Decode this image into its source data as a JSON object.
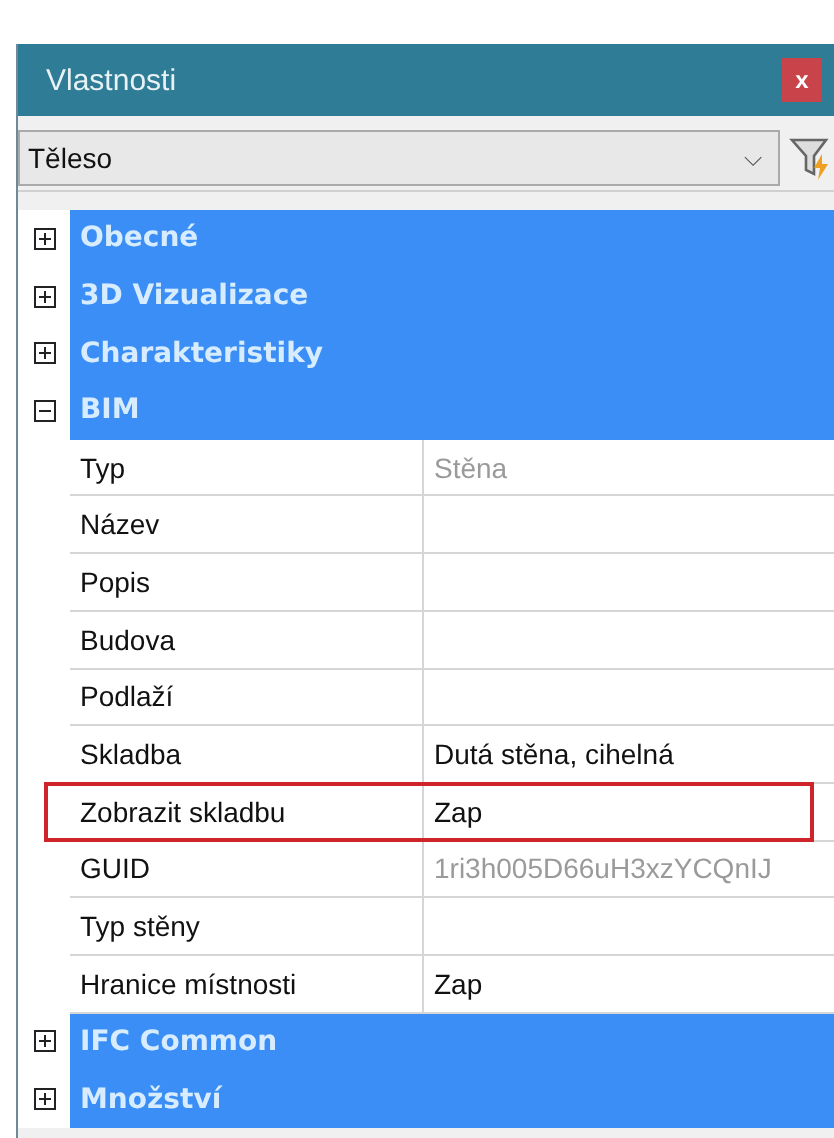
{
  "window": {
    "title": "Vlastnosti",
    "close": "x"
  },
  "selector": {
    "value": "Těleso",
    "arrow": "⌵"
  },
  "groups": [
    {
      "title": "Obecné",
      "expanded": false
    },
    {
      "title": "3D Vizualizace",
      "expanded": false
    },
    {
      "title": "Charakteristiky",
      "expanded": false
    },
    {
      "title": "BIM",
      "expanded": true,
      "rows": [
        {
          "label": "Typ",
          "value": "Stěna",
          "readonly": true,
          "highlighted": false
        },
        {
          "label": "Název",
          "value": "",
          "readonly": false,
          "highlighted": false
        },
        {
          "label": "Popis",
          "value": "",
          "readonly": false,
          "highlighted": false
        },
        {
          "label": "Budova",
          "value": "",
          "readonly": false,
          "highlighted": false
        },
        {
          "label": "Podlaží",
          "value": "",
          "readonly": false,
          "highlighted": false
        },
        {
          "label": "Skladba",
          "value": "Dutá stěna, cihelná",
          "readonly": false,
          "highlighted": false
        },
        {
          "label": "Zobrazit skladbu",
          "value": "Zap",
          "readonly": false,
          "highlighted": true
        },
        {
          "label": "GUID",
          "value": "1ri3h005D66uH3xzYCQnIJ",
          "readonly": true,
          "highlighted": false
        },
        {
          "label": "Typ stěny",
          "value": "",
          "readonly": false,
          "highlighted": false
        },
        {
          "label": "Hranice místnosti",
          "value": "Zap",
          "readonly": false,
          "highlighted": false
        }
      ]
    },
    {
      "title": "IFC Common",
      "expanded": false
    },
    {
      "title": "Množství",
      "expanded": false
    }
  ]
}
